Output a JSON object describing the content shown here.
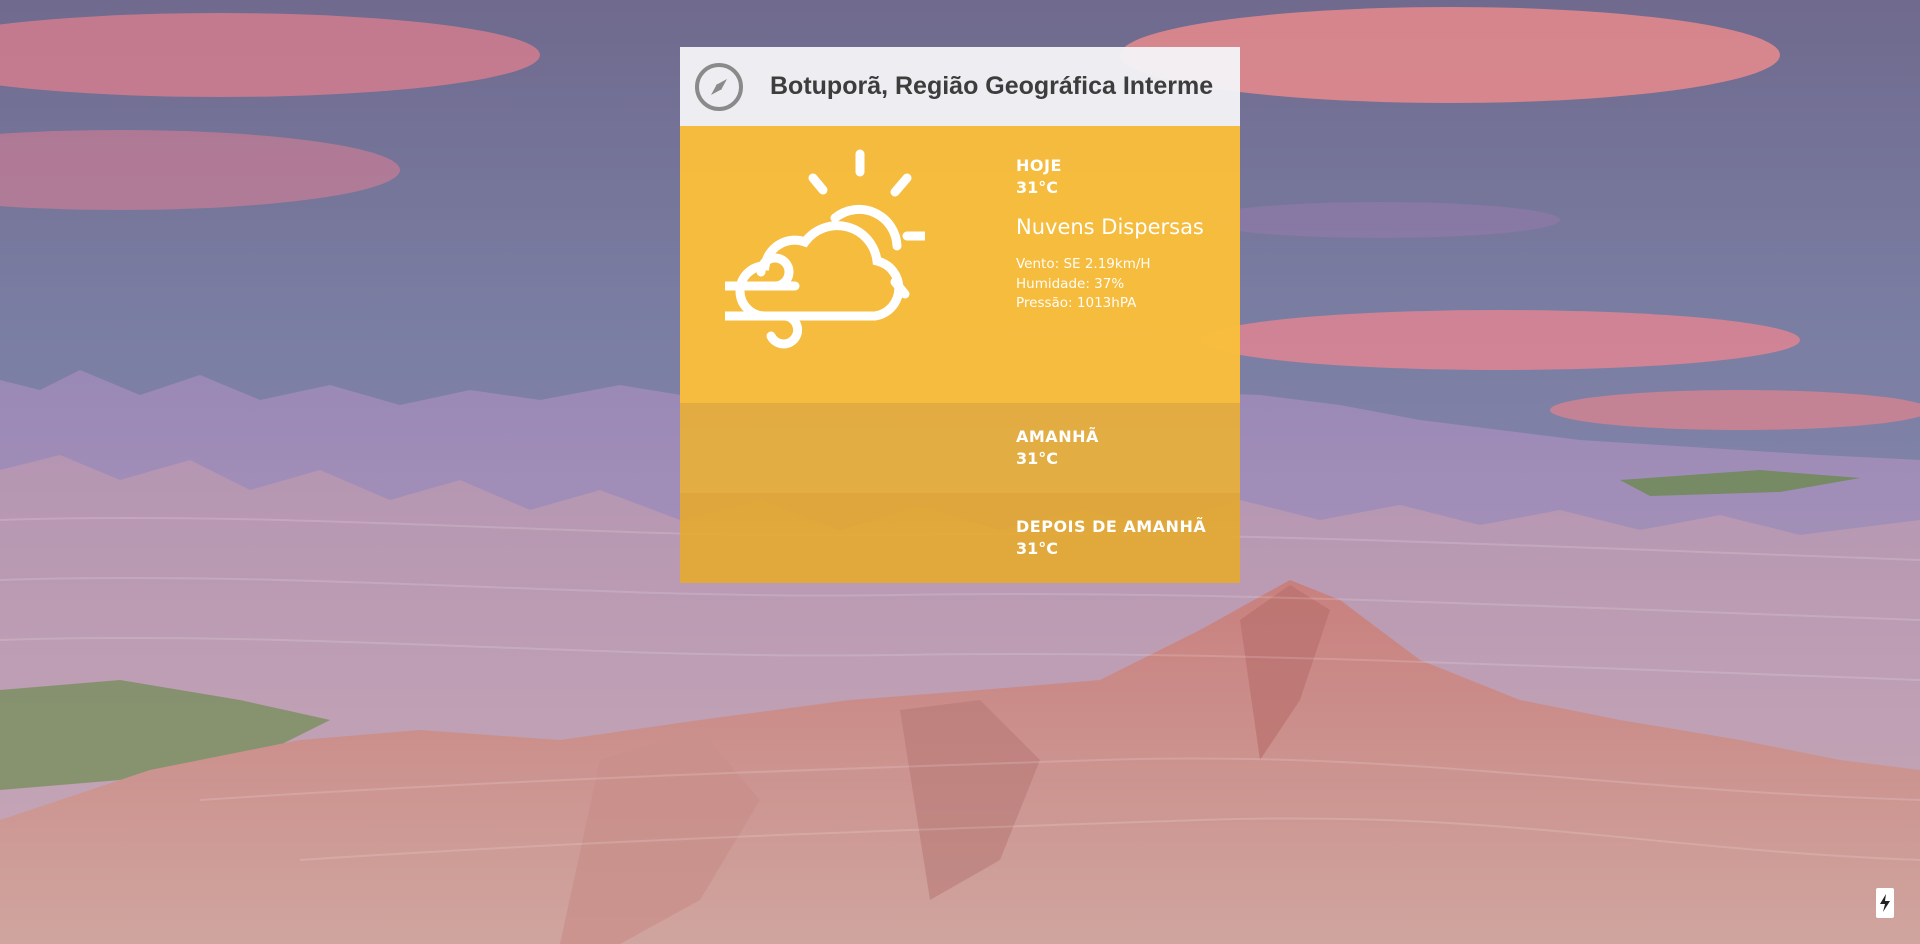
{
  "header": {
    "location": "Botuporã, Região Geográfica Interme",
    "icon": "compass-icon"
  },
  "today": {
    "label": "HOJE",
    "temp": "31°C",
    "description": "Nuvens Dispersas",
    "wind": "Vento: SE 2.19km/H",
    "humidity": "Humidade: 37%",
    "pressure": "Pressão: 1013hPA",
    "icon": "partly-cloudy-windy-icon"
  },
  "tomorrow": {
    "label": "AMANHÃ",
    "temp": "31°C"
  },
  "after_tomorrow": {
    "label": "DEPOIS DE AMANHÃ",
    "temp": "31°C"
  },
  "corner": {
    "icon": "lightning-icon"
  },
  "colors": {
    "accent": "#FABE3A",
    "header_bg": "#F3F3F6",
    "text": "#FFFFFF"
  }
}
